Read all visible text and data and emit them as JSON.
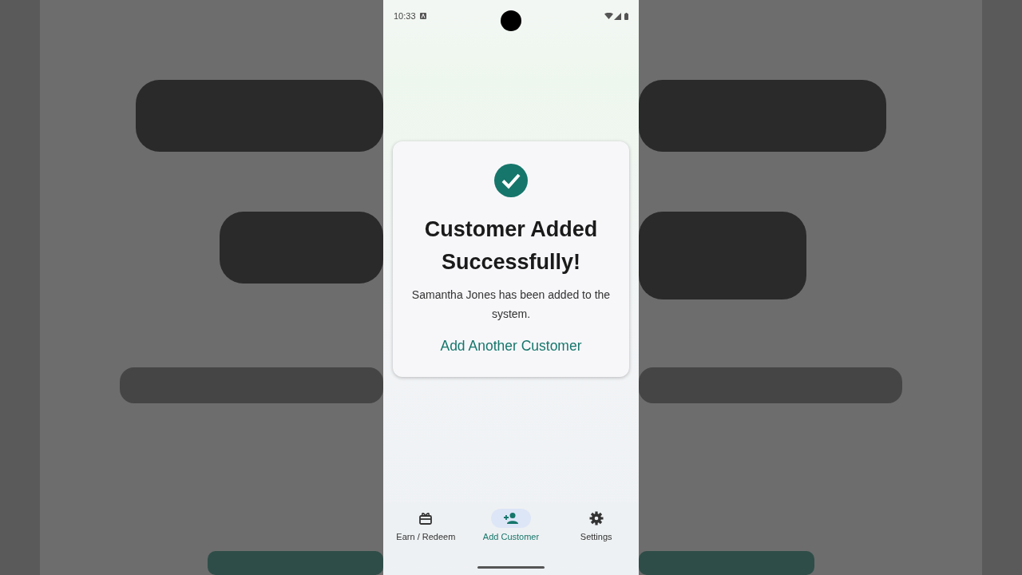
{
  "status_bar": {
    "time": "10:33"
  },
  "dialog": {
    "title": "Customer Added Successfully!",
    "message": "Samantha Jones has been added to the system.",
    "action": "Add Another Customer"
  },
  "nav_items": [
    {
      "label": "Earn / Redeem",
      "selected": false
    },
    {
      "label": "Add Customer",
      "selected": true
    },
    {
      "label": "Settings",
      "selected": false
    }
  ]
}
